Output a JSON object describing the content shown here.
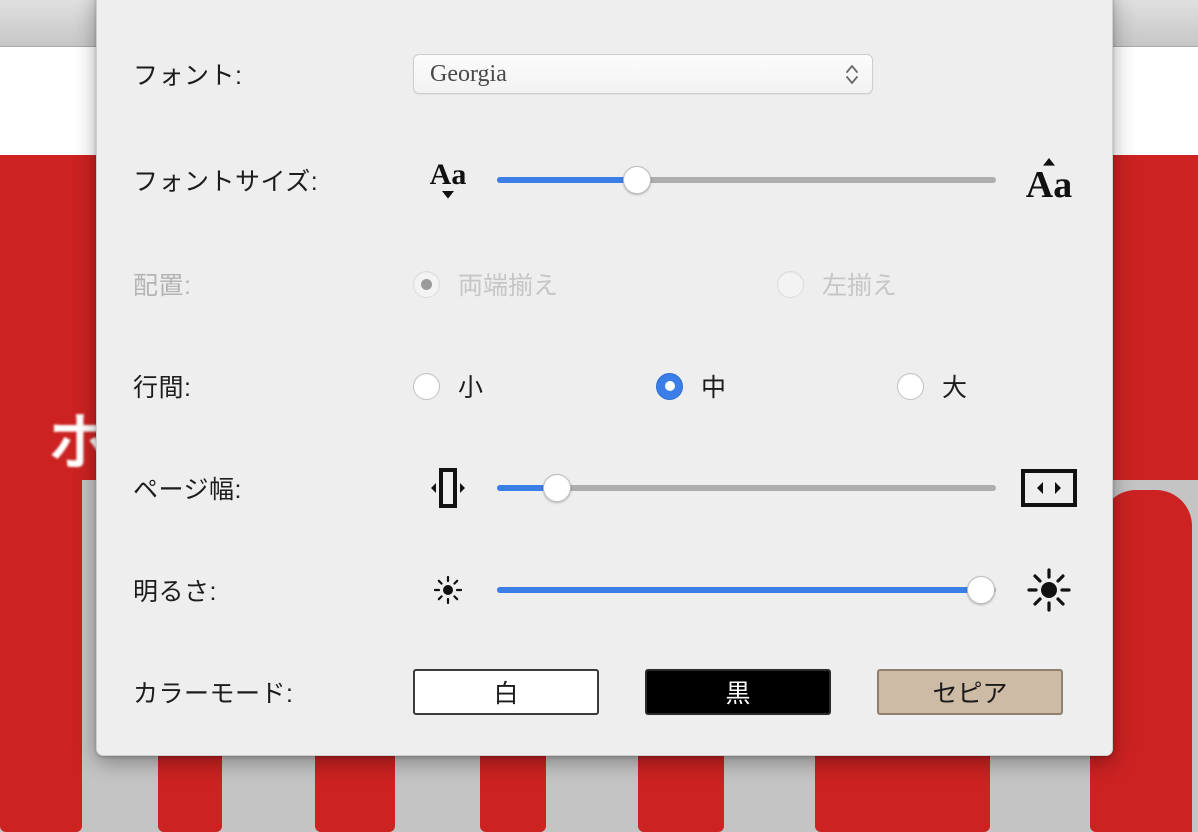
{
  "panel": {
    "title": "",
    "rows": [
      {
        "key": "font",
        "label": "フォント:",
        "type": "select",
        "value": "Georgia",
        "disabled": false
      },
      {
        "key": "font_size",
        "label": "フォントサイズ:",
        "type": "slider",
        "left_icon": "small-text-icon",
        "right_icon": "large-text-icon",
        "value_percent": 28,
        "disabled": false
      },
      {
        "key": "alignment",
        "label": "配置:",
        "type": "radio",
        "disabled": true,
        "options": [
          {
            "label": "両端揃え",
            "selected": true
          },
          {
            "label": "左揃え",
            "selected": false
          }
        ]
      },
      {
        "key": "line_spacing",
        "label": "行間:",
        "type": "radio",
        "disabled": false,
        "options": [
          {
            "label": "小",
            "selected": false
          },
          {
            "label": "中",
            "selected": true
          },
          {
            "label": "大",
            "selected": false
          }
        ]
      },
      {
        "key": "page_width",
        "label": "ページ幅:",
        "type": "slider",
        "left_icon": "narrow-page-icon",
        "right_icon": "wide-page-icon",
        "value_percent": 12,
        "disabled": false
      },
      {
        "key": "brightness",
        "label": "明るさ:",
        "type": "slider",
        "left_icon": "brightness-low-icon",
        "right_icon": "brightness-high-icon",
        "value_percent": 97,
        "disabled": false
      },
      {
        "key": "color_mode",
        "label": "カラーモード:",
        "type": "buttons",
        "disabled": false,
        "options": [
          {
            "label": "白",
            "style": "white"
          },
          {
            "label": "黒",
            "style": "black"
          },
          {
            "label": "セピア",
            "style": "sepia"
          }
        ]
      }
    ]
  },
  "background": {
    "cover_text": "ホ"
  },
  "colors": {
    "accent": "#3b7ee8",
    "panel_bg": "#eeeeee",
    "track": "#aeaeae",
    "cover_red": "#cc2222",
    "sepia": "#cdbba6"
  }
}
